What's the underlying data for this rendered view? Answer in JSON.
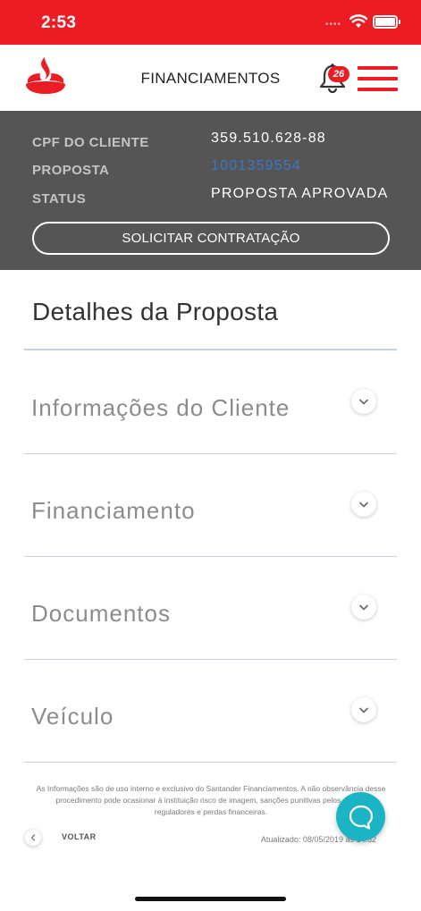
{
  "status_bar": {
    "time": "2:53",
    "icons": [
      "signal-dots-icon",
      "wifi-icon",
      "battery-icon"
    ]
  },
  "header": {
    "title": "FINANCIAMENTOS",
    "notification_count": "26",
    "icons": [
      "santander-flame-icon",
      "bell-icon",
      "hamburger-menu-icon"
    ]
  },
  "summary": {
    "rows": [
      {
        "label": "CPF DO CLIENTE",
        "value": "359.510.628-88"
      },
      {
        "label": "PROPOSTA",
        "value": "1001359554"
      },
      {
        "label": "STATUS",
        "value": "PROPOSTA APROVADA"
      }
    ],
    "action_label": "SOLICITAR CONTRATAÇÃO"
  },
  "details": {
    "title": "Detalhes da Proposta",
    "sections": [
      {
        "label": "Informações do Cliente"
      },
      {
        "label": "Financiamento"
      },
      {
        "label": "Documentos"
      },
      {
        "label": "Veículo"
      }
    ]
  },
  "footer": {
    "disclaimer": "As Informações são de uso interno e exclusivo do Santander Financiamentos. A não observância desse procedimento pode ocasionar à instituição risco de imagem, sanções punitivas pelos órgãos reguladores e perdas financeiras.",
    "back_label": "VOLTAR",
    "updated": "Atualizado: 08/05/2019 às 14:52"
  },
  "colors": {
    "brand_red": "#ec1c24",
    "panel_gray": "#555555",
    "link_blue": "#3a78c7",
    "chat_teal": "#1bb4c4",
    "divider": "#c6d0e0"
  }
}
